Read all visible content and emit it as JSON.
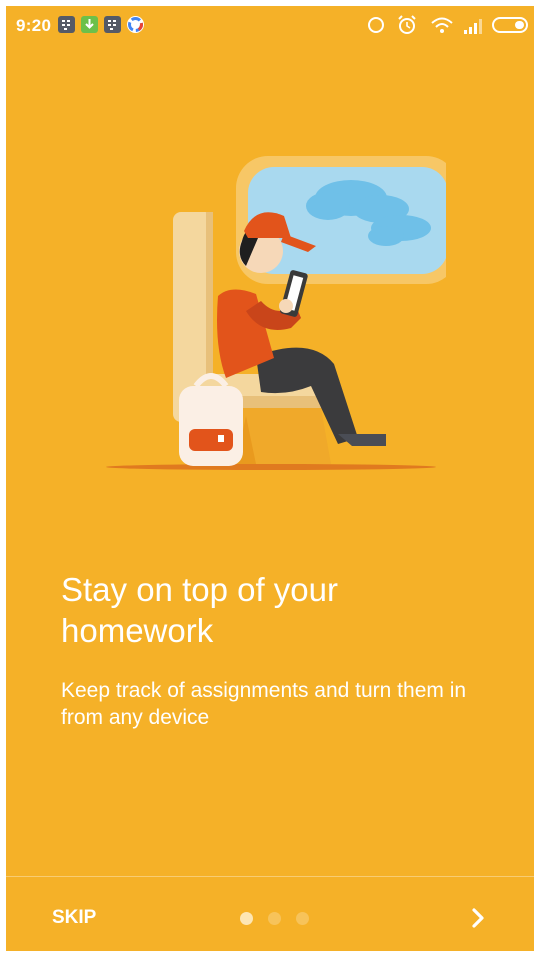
{
  "status_bar": {
    "time": "9:20",
    "notification_icons": [
      "bbm-icon",
      "download-icon",
      "bbm-icon",
      "google-icon"
    ],
    "system_icons": [
      "sync-icon",
      "alarm-icon",
      "wifi-icon",
      "signal-icon",
      "battery-icon"
    ]
  },
  "onboarding": {
    "title": "Stay on top of your homework",
    "subtitle": "Keep track of assignments and turn them in from any device",
    "illustration_icon": "student-on-train-illustration"
  },
  "footer": {
    "skip_label": "SKIP",
    "page_count": 3,
    "current_page": 1,
    "next_icon": "chevron-right-icon"
  },
  "colors": {
    "background": "#F5B128",
    "text": "#FFFFFF",
    "dot_active": "#FDE6B4",
    "dot_inactive": "#F7C35A"
  }
}
